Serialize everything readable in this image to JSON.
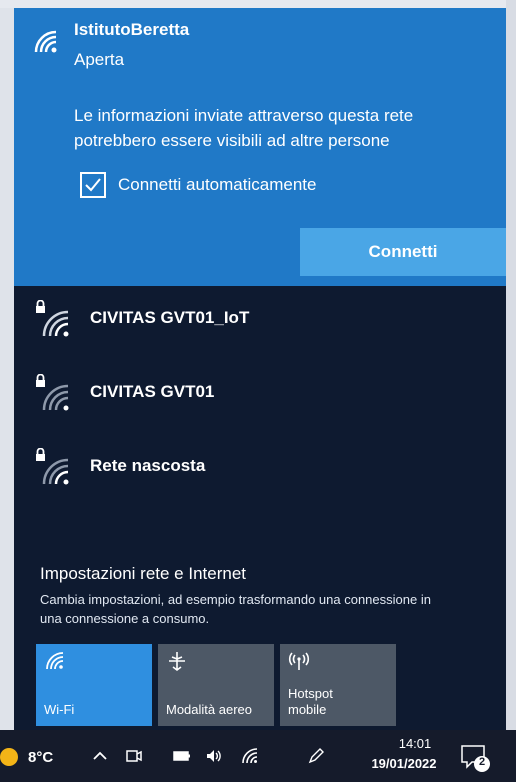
{
  "selected_network": {
    "name": "IstitutoBeretta",
    "status": "Aperta",
    "warning": "Le informazioni inviate attraverso questa rete potrebbero essere visibili ad altre persone",
    "auto_connect_label": "Connetti automaticamente",
    "auto_connect_checked": true,
    "connect_label": "Connetti",
    "icon": "wifi-open-icon"
  },
  "networks": [
    {
      "name": "CIVITAS GVT01_IoT",
      "secured": true,
      "icon": "wifi-secured-icon"
    },
    {
      "name": "CIVITAS GVT01",
      "secured": true,
      "icon": "wifi-secured-icon"
    },
    {
      "name": "Rete nascosta",
      "secured": true,
      "icon": "wifi-secured-icon"
    }
  ],
  "settings": {
    "title": "Impostazioni rete e Internet",
    "description": "Cambia impostazioni, ad esempio trasformando una connessione in una connessione a consumo."
  },
  "quick_actions": [
    {
      "label": "Wi-Fi",
      "active": true,
      "icon": "wifi-icon"
    },
    {
      "label": "Modalità aereo",
      "active": false,
      "icon": "airplane-icon"
    },
    {
      "label": "Hotspot mobile",
      "active": false,
      "icon": "hotspot-icon"
    }
  ],
  "taskbar": {
    "temperature": "8°C",
    "time": "14:01",
    "date": "19/01/2022",
    "notification_count": "2",
    "icons": [
      "chevron-up-icon",
      "meet-icon",
      "battery-icon",
      "volume-icon",
      "wifi-icon",
      "pen-icon"
    ]
  },
  "colors": {
    "selected_panel": "#2079c7",
    "connect_button": "#4aa6e6",
    "flyout_bg": "#0e1a30",
    "tile_active": "#2f8fe0",
    "tile_inactive": "#4d5866",
    "taskbar": "#151b2b"
  }
}
